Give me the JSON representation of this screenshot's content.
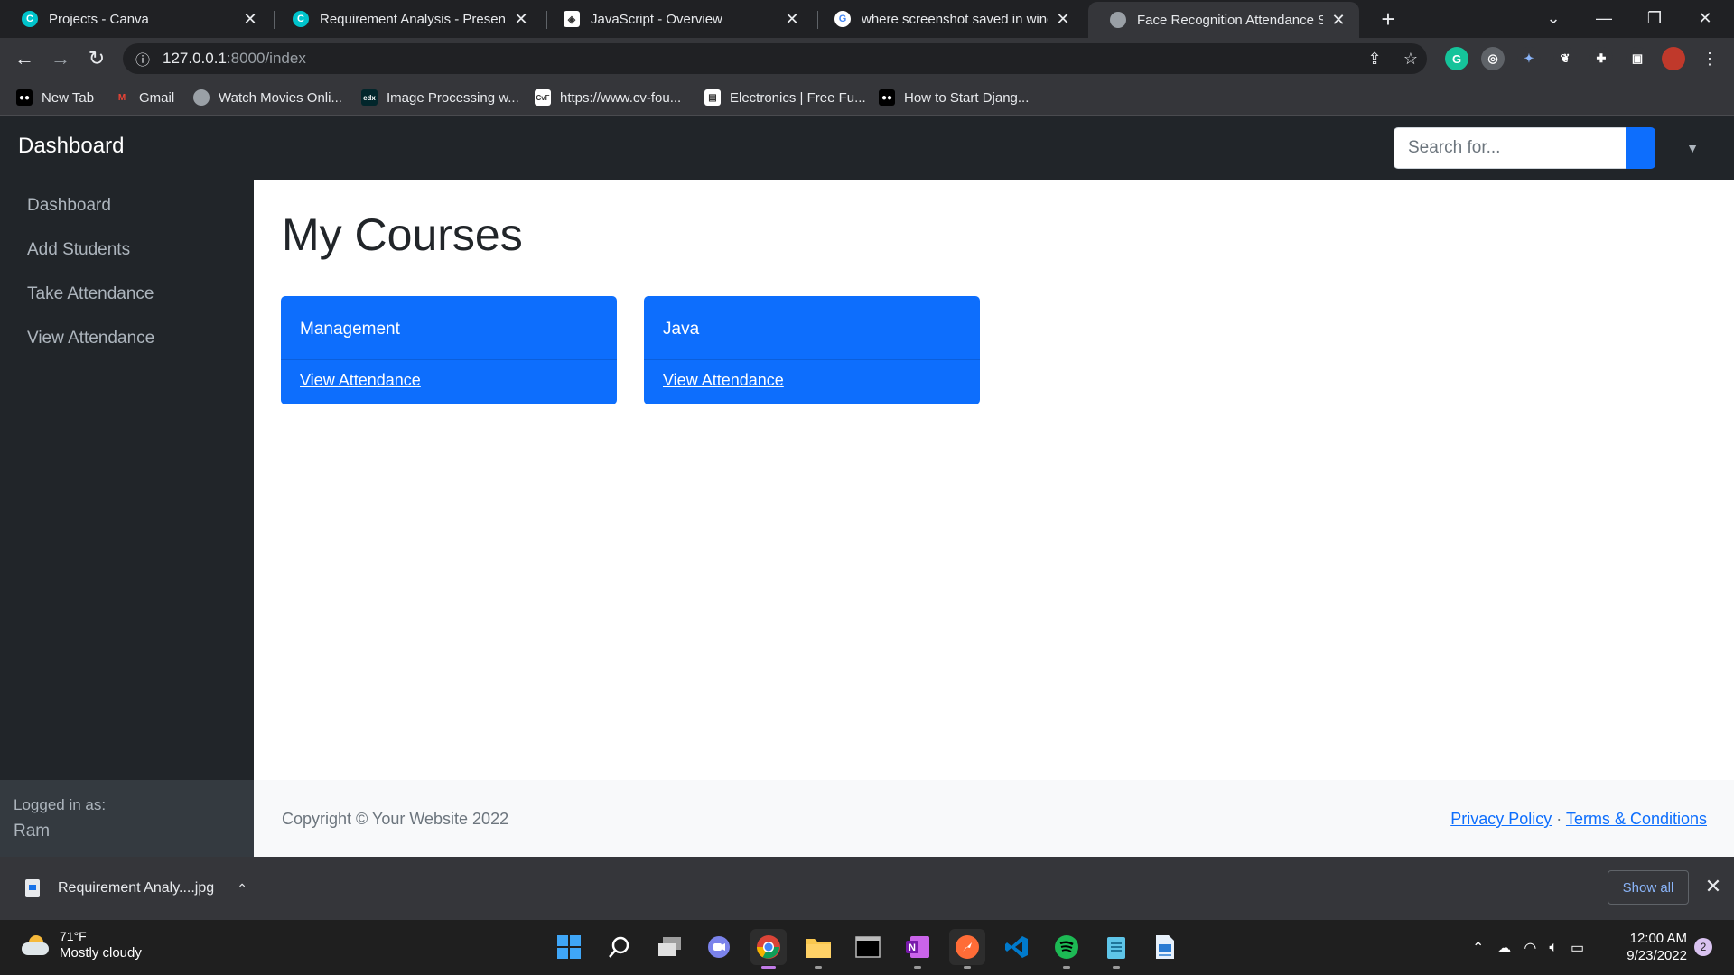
{
  "browser": {
    "tabs": [
      {
        "title": "Projects - Canva",
        "icon": "canva-icon",
        "color": "#00c4cc"
      },
      {
        "title": "Requirement Analysis - Presentat",
        "icon": "canva-icon",
        "color": "#00c4cc"
      },
      {
        "title": "JavaScript - Overview",
        "icon": "tutorialspoint-icon",
        "color": "#ffffff"
      },
      {
        "title": "where screenshot saved in windo",
        "icon": "google-icon",
        "color": "#ffffff"
      },
      {
        "title": "Face Recognition Attendance Sys",
        "icon": "globe-icon",
        "color": "#9aa0a6"
      }
    ],
    "url_host": "127.0.0.1",
    "url_path": ":8000/index",
    "bookmarks": [
      {
        "label": "New Tab",
        "icon": "medium-icon"
      },
      {
        "label": "Gmail",
        "icon": "gmail-icon"
      },
      {
        "label": "Watch Movies Onli...",
        "icon": "globe-icon"
      },
      {
        "label": "Image Processing w...",
        "icon": "edx-icon"
      },
      {
        "label": "https://www.cv-fou...",
        "icon": "cvf-icon"
      },
      {
        "label": "Electronics | Free Fu...",
        "icon": "electronics-icon"
      },
      {
        "label": "How to Start Djang...",
        "icon": "medium-icon"
      }
    ]
  },
  "app": {
    "brand": "Dashboard",
    "search_placeholder": "Search for...",
    "sidebar": {
      "items": [
        "Dashboard",
        "Add Students",
        "Take Attendance",
        "View Attendance"
      ],
      "logged_in_label": "Logged in as:",
      "user": "Ram"
    },
    "page_title": "My Courses",
    "courses": [
      {
        "name": "Management",
        "link": "View Attendance"
      },
      {
        "name": "Java",
        "link": "View Attendance"
      }
    ],
    "footer": {
      "copyright": "Copyright © Your Website 2022",
      "privacy": "Privacy Policy",
      "separator": "·",
      "terms": "Terms & Conditions"
    },
    "colors": {
      "primary": "#0d6efd",
      "dark": "#212529"
    }
  },
  "downloads": {
    "item": "Requirement Analy....jpg",
    "show_all": "Show all"
  },
  "taskbar": {
    "temperature": "71°F",
    "weather": "Mostly cloudy",
    "time": "12:00 AM",
    "date": "9/23/2022",
    "notifications": "2"
  }
}
